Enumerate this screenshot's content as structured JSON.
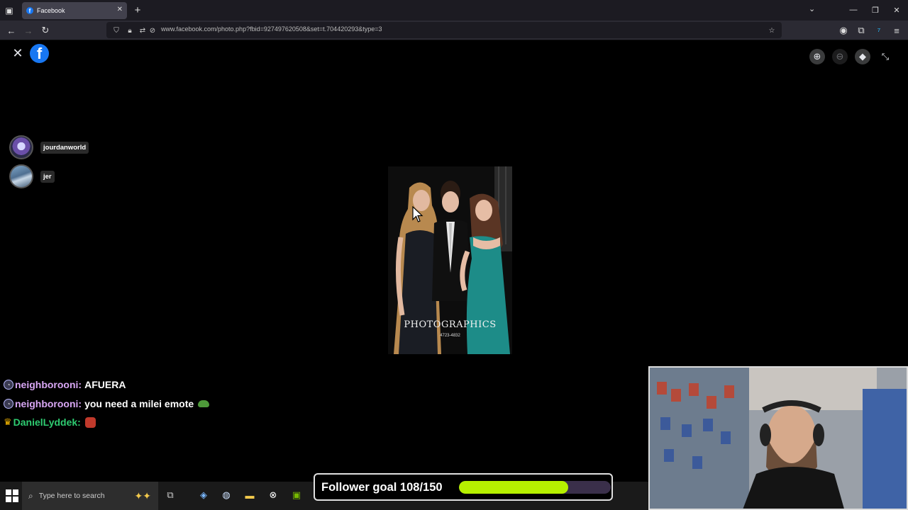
{
  "browser": {
    "tab_title": "Facebook",
    "tab_favicon_letter": "f",
    "url": "www.facebook.com/photo.php?fbid=927497620508&set=t.704420293&type=3"
  },
  "viewer": {
    "people": [
      {
        "name": "jourdanworld"
      },
      {
        "name": "jer"
      }
    ],
    "photo": {
      "watermark": "PHOTOGRAPHICS",
      "watermark_sub": "4723-4832"
    }
  },
  "chat": [
    {
      "user": "neighborooni:",
      "message": "AFUERA",
      "user_color": "#d9a7f5",
      "badge": "circle",
      "emote": ""
    },
    {
      "user": "neighborooni:",
      "message": "you need a milei emote",
      "user_color": "#d9a7f5",
      "badge": "circle",
      "emote": "frog"
    },
    {
      "user": "DanielLyddek:",
      "message": "",
      "user_color": "#2ecc71",
      "badge": "crown",
      "emote": "red-face"
    }
  ],
  "taskbar": {
    "search_placeholder": "Type here to search"
  },
  "goal": {
    "label": "Follower goal 108/150",
    "current": 108,
    "target": 150,
    "fill_color": "#b6f000"
  },
  "colors": {
    "facebook_blue": "#1877f2",
    "chrome_bg": "#1c1b22",
    "navbar_bg": "#2b2a33"
  }
}
